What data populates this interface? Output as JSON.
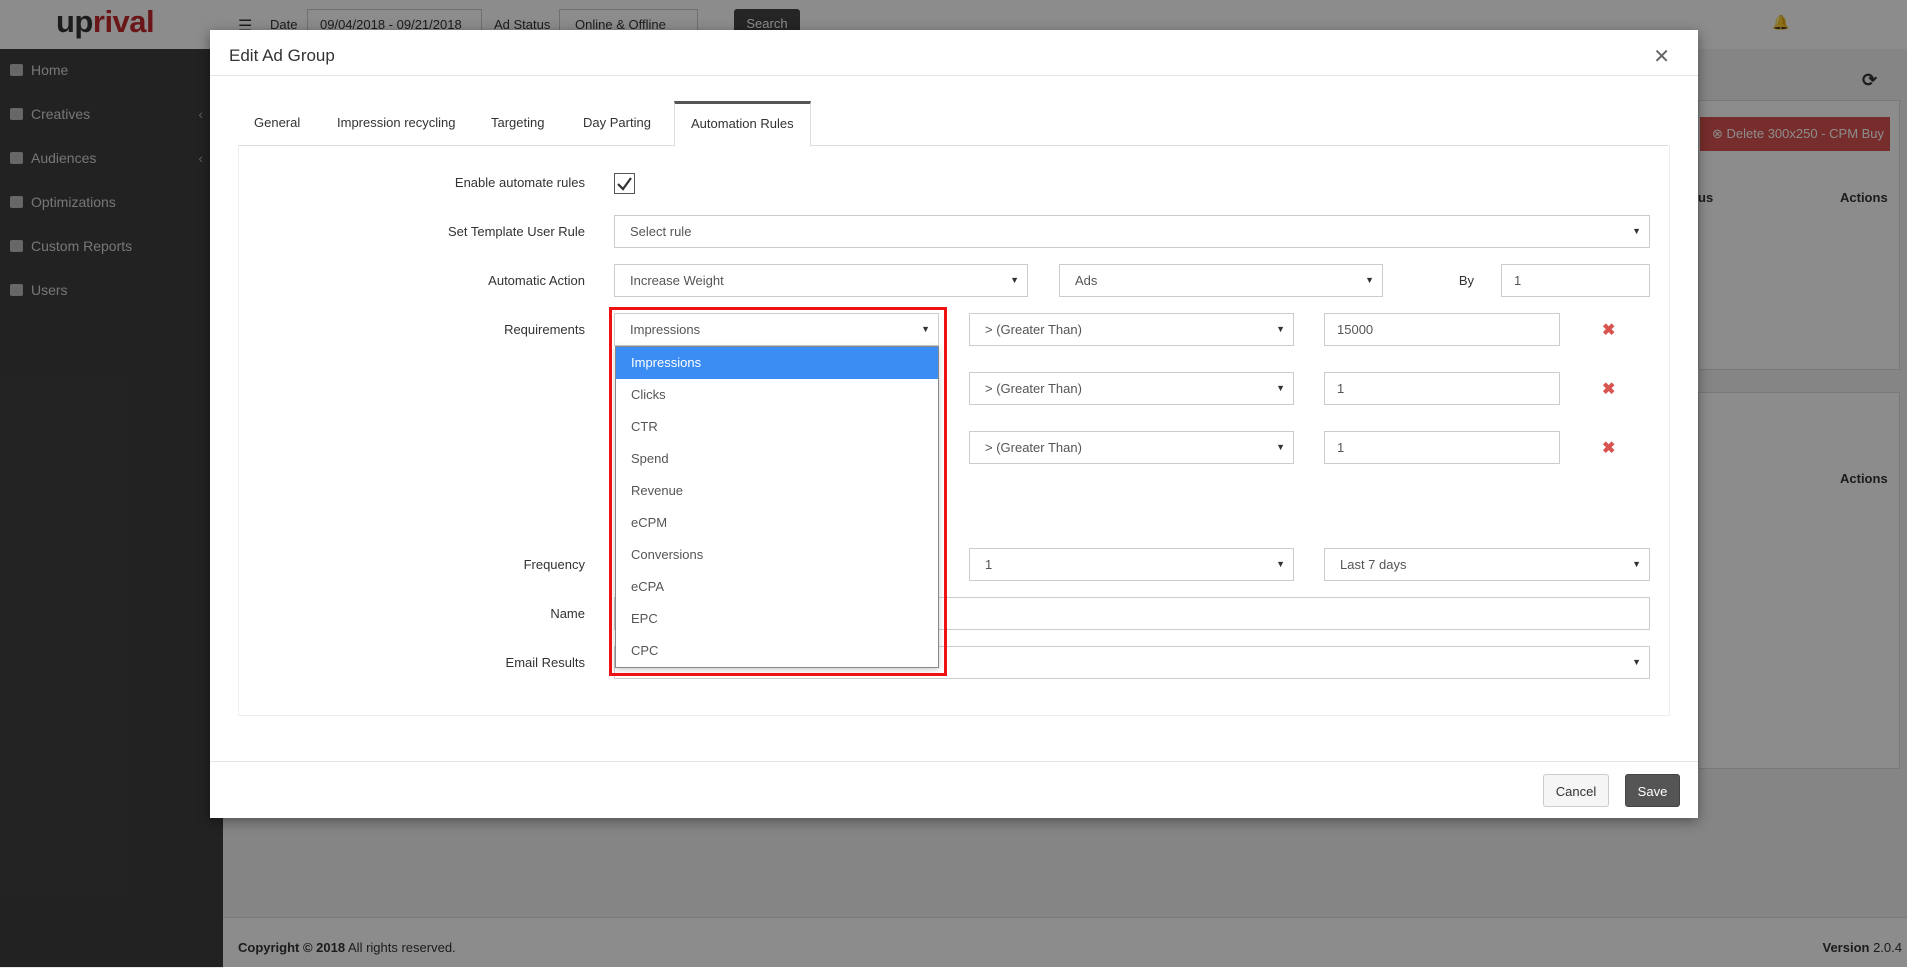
{
  "app": {
    "logo_up": "up",
    "logo_rival": "rival"
  },
  "topbar": {
    "menu_icon": "hamburger-icon",
    "date_label": "Date",
    "date_value": "09/04/2018 - 09/21/2018",
    "ad_status_label": "Ad Status",
    "ad_status_value": "Online & Offline",
    "search_label": "Search",
    "bell_icon": "bell-icon"
  },
  "sidebar": {
    "items": [
      {
        "label": "Home",
        "icon": "home-icon"
      },
      {
        "label": "Creatives",
        "icon": "image-icon"
      },
      {
        "label": "Audiences",
        "icon": "users-icon"
      },
      {
        "label": "Optimizations",
        "icon": "gears-icon"
      },
      {
        "label": "Custom Reports",
        "icon": "file-icon"
      },
      {
        "label": "Users",
        "icon": "user-icon"
      }
    ]
  },
  "background": {
    "delete_button": "Delete 300x250 - CPM Buy",
    "status_header_partial": "us",
    "actions_header": "Actions"
  },
  "modal": {
    "title": "Edit Ad Group",
    "tabs": [
      "General",
      "Impression recycling",
      "Targeting",
      "Day Parting",
      "Automation Rules"
    ],
    "active_tab": "Automation Rules",
    "form": {
      "enable_label": "Enable automate rules",
      "enable_checked": true,
      "template_label": "Set Template User Rule",
      "template_value": "Select rule",
      "action_label": "Automatic Action",
      "action_value": "Increase Weight",
      "action_target": "Ads",
      "by_label": "By",
      "by_value": "1",
      "requirements_label": "Requirements",
      "requirements": [
        {
          "metric": "Impressions",
          "operator": "> (Greater Than)",
          "value": "15000"
        },
        {
          "metric": "",
          "operator": "> (Greater Than)",
          "value": "1"
        },
        {
          "metric": "",
          "operator": "> (Greater Than)",
          "value": "1"
        }
      ],
      "frequency_label": "Frequency",
      "frequency_value": "1",
      "frequency_period": "Last 7 days",
      "name_label": "Name",
      "email_label": "Email Results"
    },
    "dropdown_options": [
      "Impressions",
      "Clicks",
      "CTR",
      "Spend",
      "Revenue",
      "eCPM",
      "Conversions",
      "eCPA",
      "EPC",
      "CPC"
    ],
    "dropdown_selected": "Impressions",
    "cancel_label": "Cancel",
    "save_label": "Save"
  },
  "footer": {
    "copyright": "Copyright © 2018",
    "rights": "All rights reserved.",
    "version_label": "Version",
    "version_value": "2.0.4"
  },
  "colors": {
    "brand_red": "#c1272d",
    "highlight_red": "#ee1111",
    "selected_blue": "#3b8cf3",
    "sidebar_bg": "#3f3f3f",
    "delete_red": "#d9534f"
  }
}
